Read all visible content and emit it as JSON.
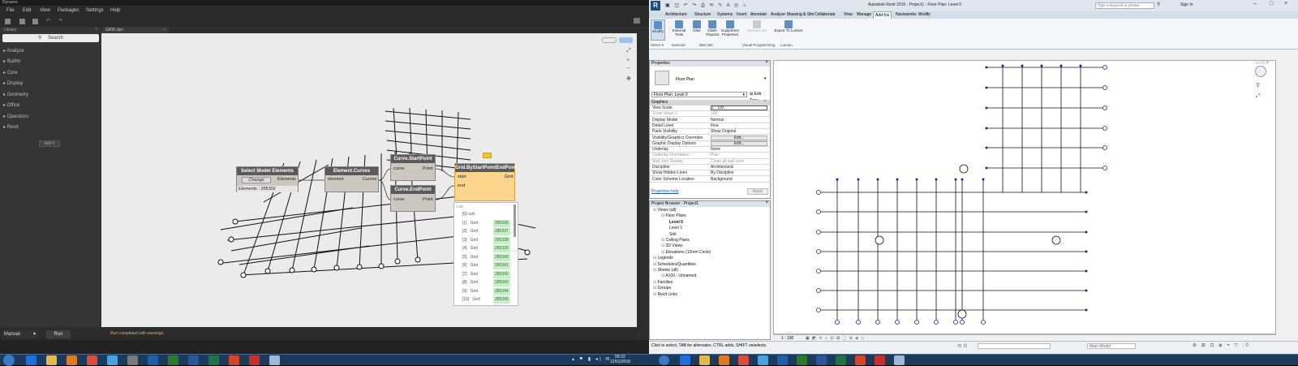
{
  "dynamo": {
    "window_title": "Dynamo",
    "menu": [
      "File",
      "Edit",
      "View",
      "Packages",
      "Settings",
      "Help"
    ],
    "library_title": "Library",
    "search_placeholder": "Search",
    "library_items": [
      "Analyze",
      "BuiltIn",
      "Core",
      "Display",
      "Geometry",
      "Office",
      "Operators",
      "Revit"
    ],
    "add_label": "Add",
    "tab_name": "GRID.dyn",
    "nodes": {
      "select": {
        "title": "Select Model Elements",
        "button": "Change",
        "port": "Elements",
        "status": "Elements : 285302"
      },
      "curves": {
        "title": "Element.Curves",
        "in": "element",
        "out": "Curves"
      },
      "start": {
        "title": "Curve.StartPoint",
        "in": "curve",
        "out": "Point"
      },
      "end": {
        "title": "Curve.EndPoint",
        "in": "curve",
        "out": "Point"
      },
      "grid": {
        "title": "Grid.ByStartPointEndPoint",
        "in1": "start",
        "in2": "end",
        "out": "Grid"
      }
    },
    "preview": {
      "header": "List",
      "rows": [
        {
          "idx": "[0] null",
          "tag": "",
          "id": ""
        },
        {
          "idx": "[1]",
          "tag": "Grid",
          "id": "285336"
        },
        {
          "idx": "[2]",
          "tag": "Grid",
          "id": "285337"
        },
        {
          "idx": "[3]",
          "tag": "Grid",
          "id": "285338"
        },
        {
          "idx": "[4]",
          "tag": "Grid",
          "id": "285339"
        },
        {
          "idx": "[5]",
          "tag": "Grid",
          "id": "285340"
        },
        {
          "idx": "[6]",
          "tag": "Grid",
          "id": "285341"
        },
        {
          "idx": "[7]",
          "tag": "Grid",
          "id": "285342"
        },
        {
          "idx": "[8]",
          "tag": "Grid",
          "id": "285343"
        },
        {
          "idx": "[9]",
          "tag": "Grid",
          "id": "285344"
        },
        {
          "idx": "[10]",
          "tag": "Grid",
          "id": "285345"
        }
      ]
    },
    "run_mode": "Manual",
    "run_label": "Run",
    "status": "Run completed with warnings."
  },
  "revit": {
    "title": "Autodesk Revit 2015 -   Project1 - Floor Plan: Level 0",
    "search_placeholder": "Type a keyword or phrase",
    "sign_in": "Sign In",
    "ribbon_tabs": [
      "Architecture",
      "Structure",
      "Systems",
      "Insert",
      "Annotate",
      "Analyze",
      "Massing & Site",
      "Collaborate",
      "View",
      "Manage",
      "Add-Ins",
      "Navisworks",
      "Modify"
    ],
    "active_tab": "Add-Ins",
    "ribbon_buttons": [
      {
        "label": "Modify",
        "group": "Select"
      },
      {
        "label": "External Tools",
        "group": "External"
      },
      {
        "label": "Glue",
        "group": "BIM 360"
      },
      {
        "label": "Clash Pinpoint",
        "group": "BIM 360"
      },
      {
        "label": "Equipment Properties",
        "group": "BIM 360"
      },
      {
        "label": "Dynamo Ed",
        "group": "Visual Programming"
      },
      {
        "label": "Export To Lumion",
        "group": "Lumion"
      }
    ],
    "groups": [
      "Select ▾",
      "External",
      "BIM 360",
      "Visual Programming",
      "Lumion"
    ],
    "properties": {
      "title": "Properties",
      "type_name": "Floor Plan",
      "selector": "Floor Plan: Level 0",
      "edit_type": "Edit Type",
      "section": "Graphics",
      "rows": [
        {
          "k": "View Scale",
          "v": "1 : 100"
        },
        {
          "k": "Scale Value    1:",
          "v": "100"
        },
        {
          "k": "Display Model",
          "v": "Normal"
        },
        {
          "k": "Detail Level",
          "v": "Fine"
        },
        {
          "k": "Parts Visibility",
          "v": "Show Original"
        },
        {
          "k": "Visibility/Graphics Overrides",
          "v": "Edit..."
        },
        {
          "k": "Graphic Display Options",
          "v": "Edit..."
        },
        {
          "k": "Underlay",
          "v": "None"
        },
        {
          "k": "Underlay Orientation",
          "v": "Plan"
        },
        {
          "k": "Wall Join Display",
          "v": "Clean all wall joins"
        },
        {
          "k": "Discipline",
          "v": "Architectural"
        },
        {
          "k": "Show Hidden Lines",
          "v": "By Discipline"
        },
        {
          "k": "Color Scheme Location",
          "v": "Background"
        }
      ],
      "help": "Properties help",
      "apply": "Apply"
    },
    "browser": {
      "title": "Project Browser - Project1",
      "items": [
        {
          "t": "Views (all)",
          "lvl": 0
        },
        {
          "t": "Floor Plans",
          "lvl": 1
        },
        {
          "t": "Level 0",
          "lvl": 2
        },
        {
          "t": "Level 1",
          "lvl": 2
        },
        {
          "t": "Site",
          "lvl": 2
        },
        {
          "t": "Ceiling Plans",
          "lvl": 1
        },
        {
          "t": "3D Views",
          "lvl": 1
        },
        {
          "t": "Elevations (12mm Circle)",
          "lvl": 1
        },
        {
          "t": "Legends",
          "lvl": 0
        },
        {
          "t": "Schedules/Quantities",
          "lvl": 0
        },
        {
          "t": "Sheets (all)",
          "lvl": 0
        },
        {
          "t": "A100 - Unnamed",
          "lvl": 1
        },
        {
          "t": "Families",
          "lvl": 0
        },
        {
          "t": "Groups",
          "lvl": 0
        },
        {
          "t": "Revit Links",
          "lvl": 0
        }
      ]
    },
    "view_scale": "1 : 100",
    "status": "Click to select, TAB for alternates, CTRL adds, SHIFT unselects.",
    "model_label": "Main Model"
  },
  "taskbar": {
    "time": "09:23",
    "date": "12/01/2016"
  }
}
